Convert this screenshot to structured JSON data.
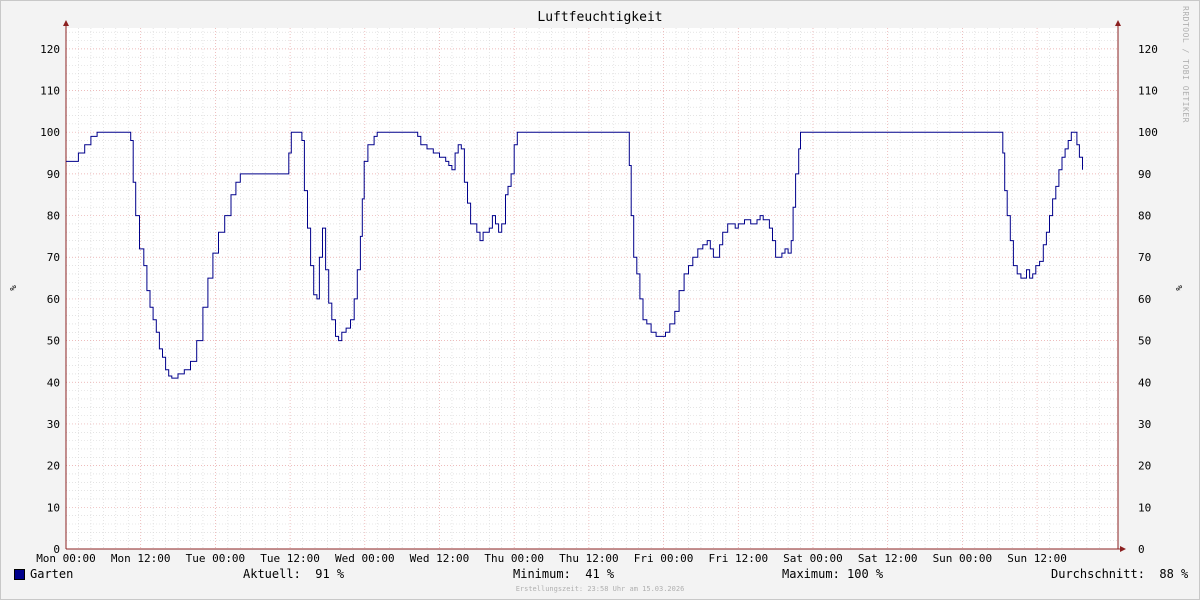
{
  "chart_data": {
    "type": "line",
    "title": "Luftfeuchtigkeit",
    "ylabel": "%",
    "ylim": [
      0,
      125
    ],
    "yticks": [
      0,
      10,
      20,
      30,
      40,
      50,
      60,
      70,
      80,
      90,
      100,
      110,
      120
    ],
    "x_tick_labels": [
      "Mon 00:00",
      "Mon 12:00",
      "Tue 00:00",
      "Tue 12:00",
      "Wed 00:00",
      "Wed 12:00",
      "Thu 00:00",
      "Thu 12:00",
      "Fri 00:00",
      "Fri 12:00",
      "Sat 00:00",
      "Sat 12:00",
      "Sun 00:00",
      "Sun 12:00"
    ],
    "x_unit": "hours since Mon 00:00",
    "xlim": [
      0,
      169
    ],
    "grid": true,
    "series": [
      {
        "name": "Garten",
        "color": "#00008b",
        "points": [
          [
            0,
            93
          ],
          [
            1,
            93
          ],
          [
            2,
            95
          ],
          [
            3,
            97
          ],
          [
            4,
            99
          ],
          [
            5,
            100
          ],
          [
            9,
            100
          ],
          [
            10,
            100
          ],
          [
            10.4,
            98
          ],
          [
            10.8,
            88
          ],
          [
            11.2,
            80
          ],
          [
            11.8,
            72
          ],
          [
            12.5,
            68
          ],
          [
            13,
            62
          ],
          [
            13.5,
            58
          ],
          [
            14,
            55
          ],
          [
            14.5,
            52
          ],
          [
            15,
            48
          ],
          [
            15.5,
            46
          ],
          [
            16,
            43
          ],
          [
            16.5,
            41.5
          ],
          [
            17,
            41
          ],
          [
            18,
            42
          ],
          [
            19,
            43
          ],
          [
            19.5,
            43
          ],
          [
            20,
            45
          ],
          [
            21,
            50
          ],
          [
            22,
            58
          ],
          [
            22.8,
            65
          ],
          [
            23.6,
            71
          ],
          [
            24.5,
            76
          ],
          [
            25.5,
            80
          ],
          [
            26.5,
            85
          ],
          [
            27.3,
            88
          ],
          [
            28,
            90
          ],
          [
            34,
            90
          ],
          [
            35.5,
            90
          ],
          [
            35.8,
            95
          ],
          [
            36.2,
            100
          ],
          [
            37.5,
            100
          ],
          [
            37.9,
            98
          ],
          [
            38.3,
            86
          ],
          [
            38.8,
            77
          ],
          [
            39.3,
            68
          ],
          [
            39.8,
            61
          ],
          [
            40.3,
            60
          ],
          [
            40.7,
            70
          ],
          [
            41.2,
            77
          ],
          [
            41.7,
            67
          ],
          [
            42.2,
            59
          ],
          [
            42.7,
            55
          ],
          [
            43.3,
            51
          ],
          [
            43.8,
            50
          ],
          [
            44.3,
            52
          ],
          [
            45,
            53
          ],
          [
            45.7,
            55
          ],
          [
            46.3,
            60
          ],
          [
            46.8,
            67
          ],
          [
            47.3,
            75
          ],
          [
            47.6,
            84
          ],
          [
            47.9,
            93
          ],
          [
            48.5,
            97
          ],
          [
            49.5,
            99
          ],
          [
            50,
            100
          ],
          [
            56,
            100
          ],
          [
            56.5,
            99
          ],
          [
            57,
            97
          ],
          [
            58,
            96
          ],
          [
            59,
            95
          ],
          [
            60,
            94
          ],
          [
            61,
            93
          ],
          [
            61.5,
            92
          ],
          [
            62,
            91
          ],
          [
            62.5,
            95
          ],
          [
            63,
            97
          ],
          [
            63.5,
            96
          ],
          [
            64,
            88
          ],
          [
            64.5,
            83
          ],
          [
            65,
            78
          ],
          [
            66,
            76
          ],
          [
            66.5,
            74
          ],
          [
            67,
            76
          ],
          [
            68,
            77
          ],
          [
            68.5,
            80
          ],
          [
            69,
            78
          ],
          [
            69.5,
            76
          ],
          [
            70,
            78
          ],
          [
            70.6,
            85
          ],
          [
            71,
            87
          ],
          [
            71.5,
            90
          ],
          [
            72,
            97
          ],
          [
            72.5,
            100
          ],
          [
            78,
            100
          ],
          [
            90,
            100
          ],
          [
            90.2,
            100
          ],
          [
            90.5,
            92
          ],
          [
            90.8,
            80
          ],
          [
            91.2,
            70
          ],
          [
            91.7,
            66
          ],
          [
            92.2,
            60
          ],
          [
            92.7,
            55
          ],
          [
            93.3,
            54
          ],
          [
            94,
            52
          ],
          [
            94.8,
            51
          ],
          [
            95.5,
            51
          ],
          [
            96.3,
            52
          ],
          [
            97,
            54
          ],
          [
            97.8,
            57
          ],
          [
            98.5,
            62
          ],
          [
            99.3,
            66
          ],
          [
            100,
            68
          ],
          [
            100.7,
            70
          ],
          [
            101.5,
            72
          ],
          [
            102.3,
            73
          ],
          [
            103,
            74
          ],
          [
            103.5,
            72
          ],
          [
            104,
            70
          ],
          [
            104.7,
            70
          ],
          [
            105,
            73
          ],
          [
            105.5,
            76
          ],
          [
            106.3,
            78
          ],
          [
            107,
            78
          ],
          [
            107.5,
            77
          ],
          [
            108,
            78
          ],
          [
            109,
            79
          ],
          [
            109.5,
            79
          ],
          [
            110,
            78
          ],
          [
            110.5,
            78
          ],
          [
            111,
            79
          ],
          [
            111.5,
            80
          ],
          [
            112,
            79
          ],
          [
            112.5,
            79
          ],
          [
            113,
            77
          ],
          [
            113.5,
            74
          ],
          [
            114,
            70
          ],
          [
            115,
            71
          ],
          [
            115.5,
            72
          ],
          [
            116,
            71
          ],
          [
            116.5,
            74
          ],
          [
            116.8,
            82
          ],
          [
            117.2,
            90
          ],
          [
            117.7,
            96
          ],
          [
            118,
            100
          ],
          [
            120,
            100
          ],
          [
            132,
            100
          ],
          [
            144,
            100
          ],
          [
            150,
            100
          ],
          [
            150.5,
            95
          ],
          [
            150.8,
            86
          ],
          [
            151.2,
            80
          ],
          [
            151.7,
            74
          ],
          [
            152.2,
            68
          ],
          [
            152.8,
            66
          ],
          [
            153.4,
            65
          ],
          [
            153.9,
            65
          ],
          [
            154.3,
            67
          ],
          [
            154.8,
            65
          ],
          [
            155.3,
            66
          ],
          [
            155.8,
            68
          ],
          [
            156.4,
            69
          ],
          [
            157,
            73
          ],
          [
            157.5,
            76
          ],
          [
            158,
            80
          ],
          [
            158.5,
            84
          ],
          [
            159,
            87
          ],
          [
            159.5,
            91
          ],
          [
            160,
            94
          ],
          [
            160.5,
            96
          ],
          [
            161,
            98
          ],
          [
            161.5,
            100
          ],
          [
            162,
            100
          ],
          [
            162.4,
            97
          ],
          [
            162.8,
            94
          ],
          [
            163.3,
            91
          ]
        ]
      }
    ],
    "legend": {
      "position": "bottom-left",
      "series_label": "Garten",
      "aktuell": "Aktuell:  91 %",
      "minimum": "Minimum:  41 %",
      "maximum": "Maximum: 100 %",
      "durchschnitt": "Durchschnitt:  88 %"
    },
    "colors": {
      "line": "#00008b",
      "major_grid": "#e8a6a6",
      "minor_grid": "#d4d4d4",
      "axis": "#8b2020",
      "background": "#f3f3f3",
      "plot_bg": "#ffffff"
    }
  },
  "watermark": "RRDTOOL / TOBI OETIKER",
  "footer": "Erstellungszeit: 23:58 Uhr am 15.03.2026"
}
